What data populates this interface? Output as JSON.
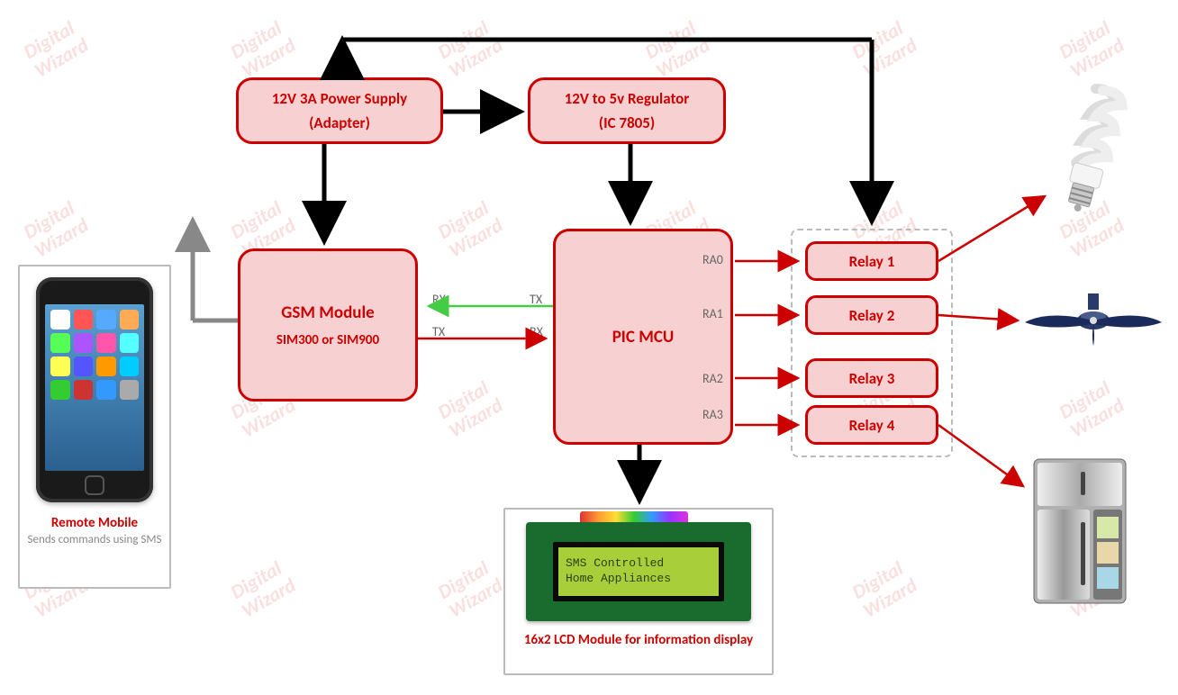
{
  "watermark": "Digital\nWizard",
  "blocks": {
    "power": {
      "line1": "12V 3A Power Supply",
      "line2": "(Adapter)"
    },
    "regulator": {
      "line1": "12V to 5v Regulator",
      "line2": "(IC 7805)"
    },
    "gsm": {
      "title": "GSM Module",
      "sub": "SIM300  or  SIM900"
    },
    "mcu": {
      "title": "PIC MCU"
    }
  },
  "pins": {
    "ra0": "RA0",
    "ra1": "RA1",
    "ra2": "RA2",
    "ra3": "RA3"
  },
  "conn": {
    "rx": "RX",
    "tx": "TX"
  },
  "relays": {
    "r1": "Relay 1",
    "r2": "Relay 2",
    "r3": "Relay 3",
    "r4": "Relay 4"
  },
  "mobile": {
    "title": "Remote Mobile",
    "sub": "Sends commands using SMS"
  },
  "lcd": {
    "line1": "SMS Controlled",
    "line2": "Home Appliances",
    "caption": "16x2 LCD Module for information display"
  }
}
